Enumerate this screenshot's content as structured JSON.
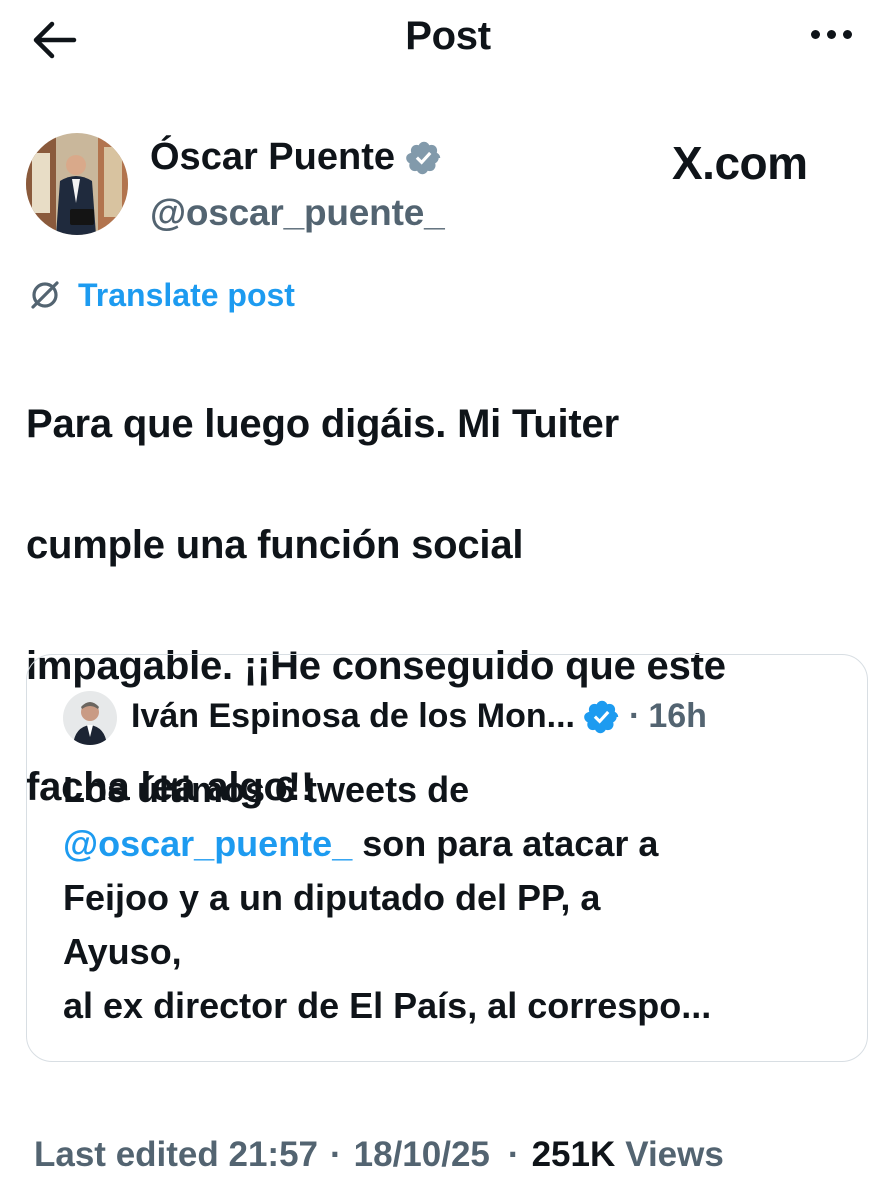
{
  "header": {
    "title": "Post",
    "back_icon": "back-arrow-icon",
    "more_icon": "more-dots-icon"
  },
  "author": {
    "name": "Óscar Puente",
    "handle": "@oscar_puente_",
    "verified": true,
    "verified_color": "#829aab"
  },
  "watermark": {
    "text": "X.com"
  },
  "translate": {
    "label": "Translate post",
    "icon": "globe-slash-icon"
  },
  "post": {
    "text_lines": [
      "Para que luego digáis. Mi Tuiter",
      "cumple una función social",
      "impagable. ¡¡He conseguido que este",
      "facha lea algo!!"
    ]
  },
  "quote": {
    "author_name": "Iván Espinosa de los Mon...",
    "verified": true,
    "verified_color": "#1d9bf0",
    "separator": "·",
    "time": "16h",
    "line1": "Los últimos 6 tweets de",
    "mention": "@oscar_puente_",
    "line2_rest": " son para atacar a",
    "line3": "Feijoo y a un diputado del PP, a",
    "line4": "Ayuso,",
    "line5": "al ex director de El País, al correspo..."
  },
  "footer": {
    "edited_label": "Last edited 21:57",
    "separator": "·",
    "date": "18/10/25",
    "views_count": "251K",
    "views_label": "Views"
  },
  "colors": {
    "accent": "#1d9bf0",
    "text": "#0f1419",
    "muted": "#536471",
    "border": "#d8dee3"
  }
}
